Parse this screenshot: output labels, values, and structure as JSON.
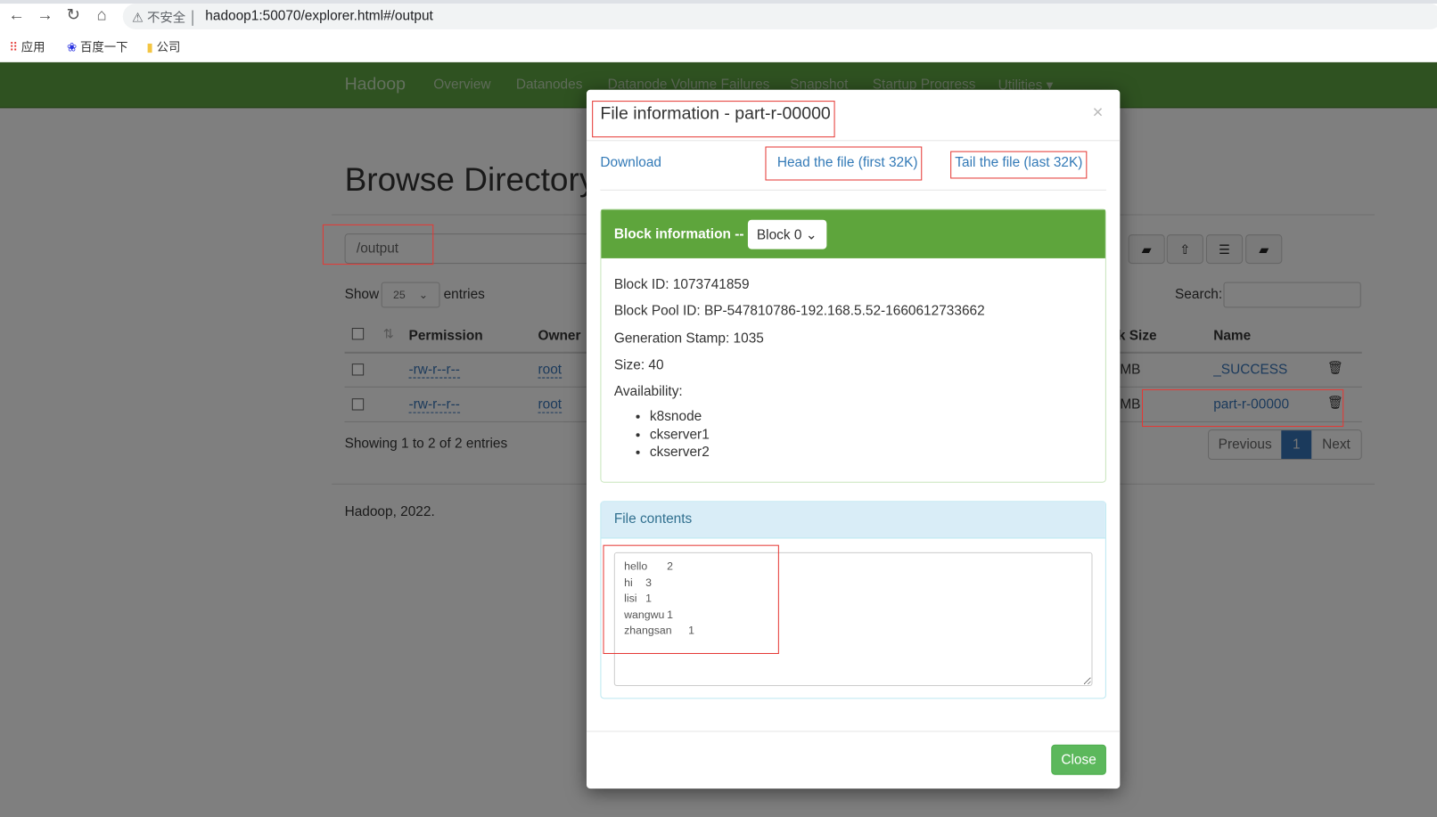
{
  "browser": {
    "url": "hadoop1:50070/explorer.html#/output",
    "security": "不安全",
    "bookmarks": [
      {
        "label": "应用",
        "icon": "apps-grid-icon"
      },
      {
        "label": "百度一下",
        "icon": "baidu-paw-icon"
      },
      {
        "label": "公司",
        "icon": "folder-icon"
      }
    ]
  },
  "navbar": {
    "brand": "Hadoop",
    "items": [
      "Overview",
      "Datanodes",
      "Datanode Volume Failures",
      "Snapshot",
      "Startup Progress",
      "Utilities ▾"
    ],
    "color": "#2f5221"
  },
  "page": {
    "title": "Browse Directory",
    "path": "/output",
    "show": "Show",
    "entries_value": "25",
    "entries": "entries",
    "search_label": "Search:",
    "columns": [
      "Permission",
      "Owner",
      "Block Size",
      "Name"
    ],
    "rows": [
      {
        "permission": "-rw-r--r--",
        "owner": "root",
        "size": "MB",
        "name": "_SUCCESS"
      },
      {
        "permission": "-rw-r--r--",
        "owner": "root",
        "size": "MB",
        "name": "part-r-00000"
      }
    ],
    "showing": "Showing 1 to 2 of 2 entries",
    "prev": "Previous",
    "page": "1",
    "next": "Next",
    "footer": "Hadoop, 2022."
  },
  "modal": {
    "title": "File information - part-r-00000",
    "close_x": "×",
    "download": "Download",
    "head": "Head the file (first 32K)",
    "tail": "Tail the file (last 32K)",
    "block_label": "Block information --",
    "block_select": "Block 0",
    "block_id": "Block ID: 1073741859",
    "pool_id": "Block Pool ID: BP-547810786-192.168.5.52-1660612733662",
    "gen_stamp": "Generation Stamp: 1035",
    "size": "Size: 40",
    "availability": "Availability:",
    "nodes": [
      "k8snode",
      "ckserver1",
      "ckserver2"
    ],
    "contents_label": "File contents",
    "contents": "hello\t2\nhi\t3\nlisi\t1\nwangwu\t1\nzhangsan\t1",
    "close": "Close"
  }
}
